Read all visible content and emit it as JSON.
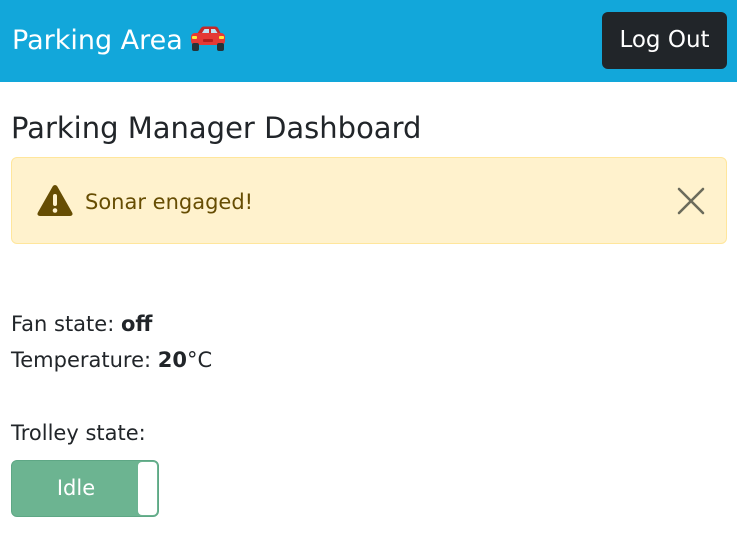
{
  "navbar": {
    "brand_text": "Parking Area",
    "brand_icon": "car-icon",
    "background_color": "#12a7da",
    "logout_label": "Log Out"
  },
  "page": {
    "title": "Parking Manager Dashboard"
  },
  "alert": {
    "icon": "warning-triangle-icon",
    "message": "Sonar engaged!",
    "close_icon": "close-icon",
    "background_color": "#fff2cd",
    "text_color": "#664d03"
  },
  "status": {
    "fan_label": "Fan state: ",
    "fan_value": "off",
    "temperature_label": "Temperature: ",
    "temperature_value": "20",
    "temperature_unit": "°C",
    "trolley_label": "Trolley state:"
  },
  "trolley_toggle": {
    "label": "Idle",
    "color": "#6cb491"
  }
}
